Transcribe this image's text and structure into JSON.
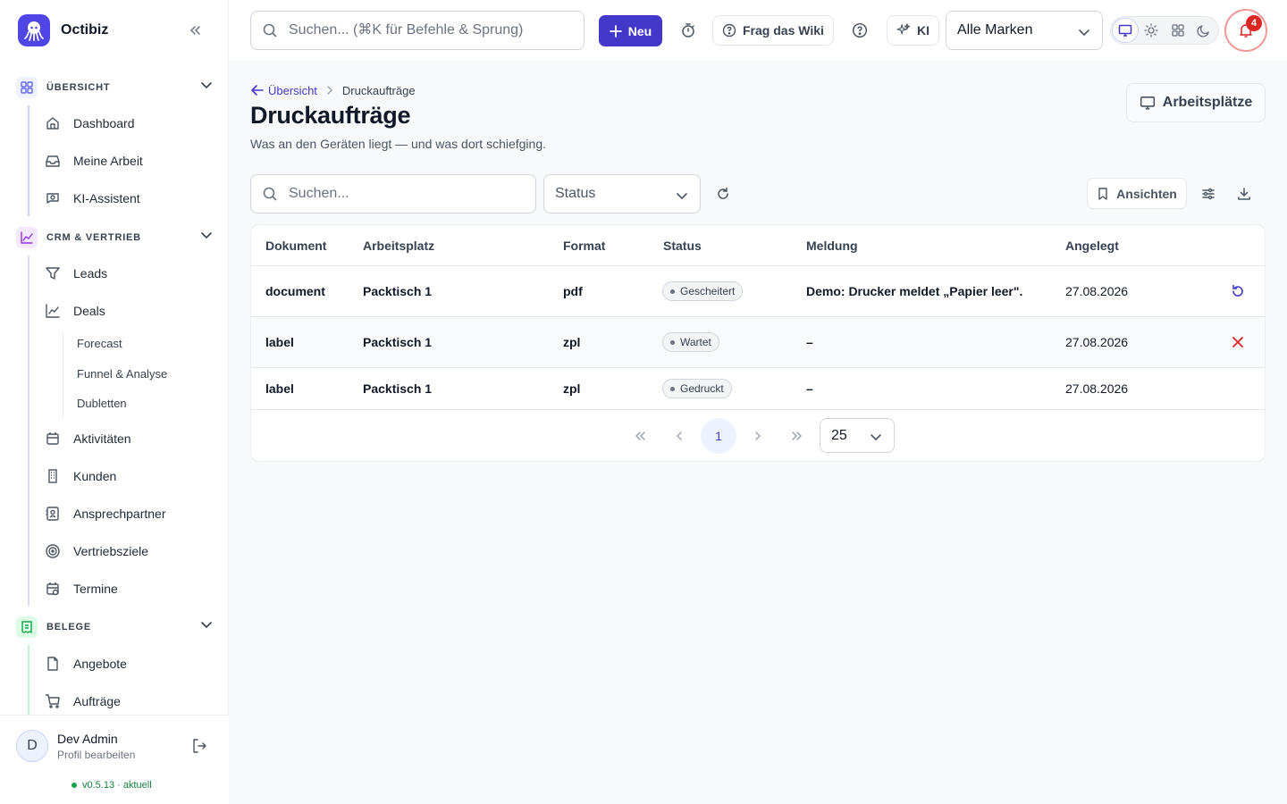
{
  "app": {
    "name": "Octibiz"
  },
  "sidebar": {
    "sections": [
      {
        "title": "ÜBERSICHT",
        "items": [
          "Dashboard",
          "Meine Arbeit",
          "KI-Assistent"
        ]
      },
      {
        "title": "CRM & VERTRIEB",
        "items": [
          "Leads",
          "Deals",
          "Aktivitäten",
          "Kunden",
          "Ansprechpartner",
          "Vertriebsziele",
          "Termine"
        ],
        "deal_subitems": [
          "Forecast",
          "Funnel & Analyse",
          "Dubletten"
        ]
      },
      {
        "title": "BELEGE",
        "items": [
          "Angebote",
          "Aufträge"
        ]
      }
    ],
    "user": {
      "name": "Dev Admin",
      "initial": "D",
      "link": "Profil bearbeiten"
    },
    "version": "v0.5.13 · aktuell"
  },
  "topbar": {
    "search_placeholder": "Suchen... (⌘K für Befehle & Sprung)",
    "new_label": "Neu",
    "wiki_label": "Frag das Wiki",
    "ai_label": "KI",
    "brand_select": "Alle Marken",
    "notification_count": "4"
  },
  "page": {
    "breadcrumb_back": "Übersicht",
    "breadcrumb_current": "Druckaufträge",
    "title": "Druckaufträge",
    "subtitle": "Was an den Geräten liegt — und was dort schiefging.",
    "workstations_button": "Arbeitsplätze"
  },
  "toolbar": {
    "search_placeholder": "Suchen...",
    "status_filter": "Status",
    "views_label": "Ansichten"
  },
  "table": {
    "columns": [
      "Dokument",
      "Arbeitsplatz",
      "Format",
      "Status",
      "Meldung",
      "Angelegt"
    ],
    "rows": [
      {
        "document": "document",
        "workstation": "Packtisch 1",
        "format": "pdf",
        "status": "Gescheitert",
        "message": "Demo: Drucker meldet „Papier leer\".",
        "created": "27.08.2026",
        "action": "retry-icon"
      },
      {
        "document": "label",
        "workstation": "Packtisch 1",
        "format": "zpl",
        "status": "Wartet",
        "message": "–",
        "created": "27.08.2026",
        "action": "cancel-icon"
      },
      {
        "document": "label",
        "workstation": "Packtisch 1",
        "format": "zpl",
        "status": "Gedruckt",
        "message": "–",
        "created": "27.08.2026",
        "action": ""
      }
    ]
  },
  "pagination": {
    "current_page": "1",
    "page_size": "25"
  },
  "colors": {
    "accent": "#4338ca",
    "danger": "#dc2626",
    "success": "#16a34a"
  }
}
